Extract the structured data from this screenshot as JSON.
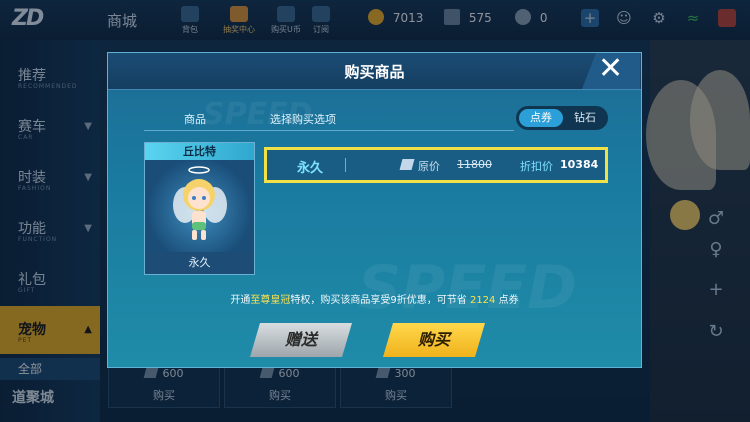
{
  "header": {
    "logo_text": "ZD",
    "shop_title": "商城",
    "nav": [
      {
        "label": "背包"
      },
      {
        "label": "抽奖中心"
      },
      {
        "label": "购买U币"
      },
      {
        "label": "订阅"
      }
    ],
    "resources": [
      {
        "icon": "coin-icon",
        "value": "7013",
        "color": "#f5b42a"
      },
      {
        "icon": "coupon-icon",
        "value": "575",
        "color": "#6f8aa8"
      },
      {
        "icon": "chat-icon",
        "value": "0",
        "color": "#8fa6bd"
      }
    ]
  },
  "sidebar": {
    "items": [
      {
        "label": "推荐",
        "sub": "RECOMMENDED"
      },
      {
        "label": "赛车",
        "sub": "CAR"
      },
      {
        "label": "时装",
        "sub": "FASHION"
      },
      {
        "label": "功能",
        "sub": "FUNCTION"
      },
      {
        "label": "礼包",
        "sub": "GIFT"
      },
      {
        "label": "宠物",
        "sub": "PET"
      }
    ],
    "sub_selected": "全部",
    "footer": "道聚城"
  },
  "products": [
    {
      "price": "600",
      "buy": "购买"
    },
    {
      "price": "600",
      "buy": "购买"
    },
    {
      "price": "300",
      "buy": "购买"
    }
  ],
  "modal": {
    "title": "购买商品",
    "tab_product": "商品",
    "tab_options": "选择购买选项",
    "currency_coupon": "点券",
    "currency_diamond": "钻石",
    "item_name": "丘比特",
    "item_duration": "永久",
    "option": {
      "duration": "永久",
      "orig_label": "原价",
      "orig_price": "11800",
      "disc_label": "折扣价",
      "disc_price": "10384"
    },
    "promo": {
      "pre": "开通",
      "vip": "至尊皇冠",
      "mid": "特权，购买该商品享受9折优惠，可节省",
      "save": "2124",
      "post": "点券"
    },
    "gift_label": "赠送",
    "buy_label": "购买"
  },
  "colors": {
    "accent": "#f0b427",
    "highlight_border": "#f1e046",
    "tab_active": "#2a9fd8"
  }
}
